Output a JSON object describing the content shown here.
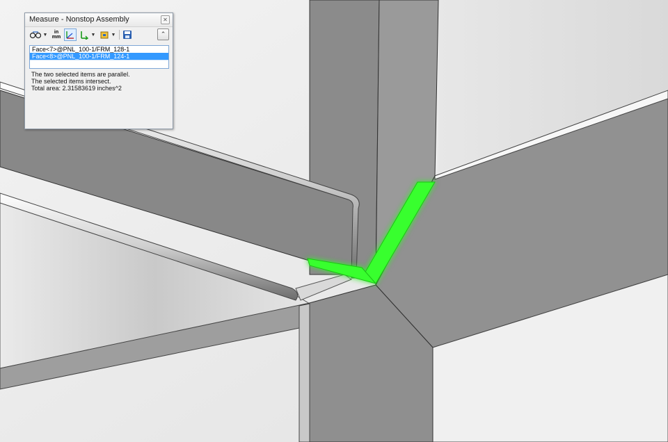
{
  "window": {
    "title": "Measure - Nonstop Assembly",
    "close_icon": "close-icon"
  },
  "toolbar": {
    "buttons": [
      {
        "name": "arc-circle-measure-icon"
      },
      {
        "name": "units-precision-icon",
        "label_top": "in",
        "label_bottom": "mm"
      },
      {
        "name": "xyz-coordinate-icon",
        "label": "XYZ"
      },
      {
        "name": "point-to-point-icon"
      },
      {
        "name": "create-sensor-icon"
      },
      {
        "name": "save-icon"
      }
    ],
    "collapse_glyph": "⌃"
  },
  "selection": {
    "items": [
      "Face<7>@PNL_100-1/FRM_128-1",
      "Face<8>@PNL_100-1/FRM_124-1"
    ]
  },
  "results": {
    "line1": "The two selected items are parallel.",
    "line2": "The selected items intersect.",
    "line3": "Total area: 2.31583619 inches^2"
  },
  "colors": {
    "highlight": "#39ff2e",
    "selection_active": "#3399ff",
    "background": "#ececec"
  }
}
